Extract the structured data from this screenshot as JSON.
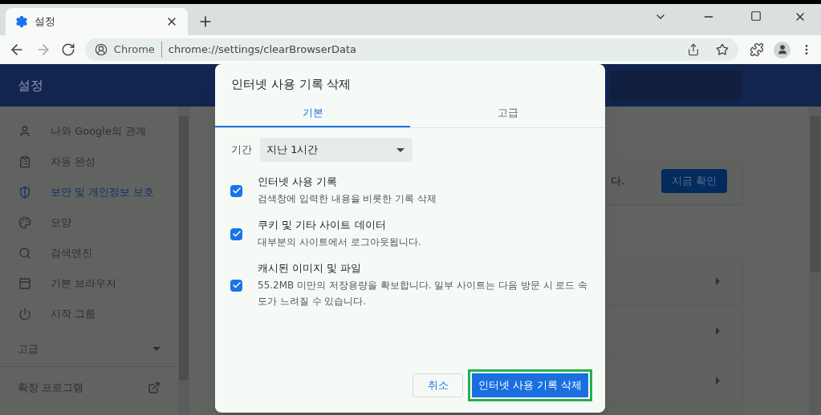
{
  "browser": {
    "tab": {
      "title": "설정"
    },
    "address": {
      "origin": "Chrome",
      "url": "chrome://settings/clearBrowserData"
    }
  },
  "settings": {
    "header": {
      "title": "설정"
    },
    "sidebar": {
      "items": [
        {
          "label": "나와 Google의 관계",
          "selected": false
        },
        {
          "label": "자동 완성",
          "selected": false
        },
        {
          "label": "보안 및 개인정보 보호",
          "selected": true
        },
        {
          "label": "모양",
          "selected": false
        },
        {
          "label": "검색엔진",
          "selected": false
        },
        {
          "label": "기본 브라우저",
          "selected": false
        },
        {
          "label": "시작 그룹",
          "selected": false
        }
      ],
      "advanced": {
        "label": "고급",
        "expanded": false
      },
      "extensions": {
        "label": "확장 프로그램"
      }
    },
    "safety_card": {
      "text": "다.",
      "button": "지금 확인"
    }
  },
  "dialog": {
    "title": "인터넷 사용 기록 삭제",
    "tabs": [
      {
        "label": "기본",
        "selected": true
      },
      {
        "label": "고급",
        "selected": false
      }
    ],
    "period": {
      "label": "기간",
      "value": "지난 1시간"
    },
    "options": [
      {
        "title": "인터넷 사용 기록",
        "description": "검색창에 입력한 내용을 비롯한 기록 삭제",
        "checked": true
      },
      {
        "title": "쿠키 및 기타 사이트 데이터",
        "description": "대부분의 사이트에서 로그아웃됩니다.",
        "checked": true
      },
      {
        "title": "캐시된 이미지 및 파일",
        "description": "55.2MB 미만의 저장용량을 확보합니다. 일부 사이트는 다음 방문 시 로드 속도가 느려질 수 있습니다.",
        "checked": true
      }
    ],
    "buttons": {
      "cancel": "취소",
      "confirm": "인터넷 사용 기록 삭제"
    }
  }
}
